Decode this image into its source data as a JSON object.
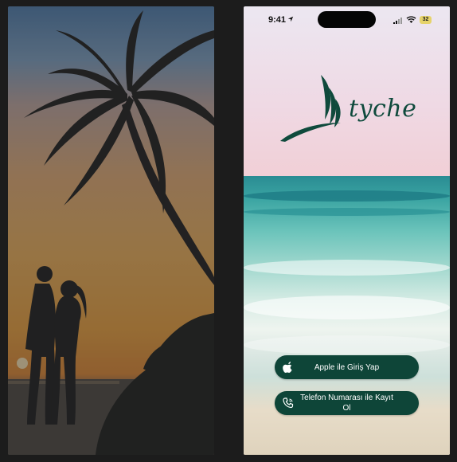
{
  "left_panel": {
    "image": "couple-under-palm-tree-sunset-photo"
  },
  "phone": {
    "status_bar": {
      "time": "9:41",
      "battery": "32"
    },
    "brand": {
      "name": "tyche",
      "logo": "leaf-wave-logo"
    },
    "buttons": {
      "apple_label": "Apple ile Giriş Yap",
      "phone_label": "Telefon Numarası ile Kayıt Ol"
    },
    "colors": {
      "brand_green": "#0e4538",
      "logo_green": "#0f4a3c"
    }
  }
}
